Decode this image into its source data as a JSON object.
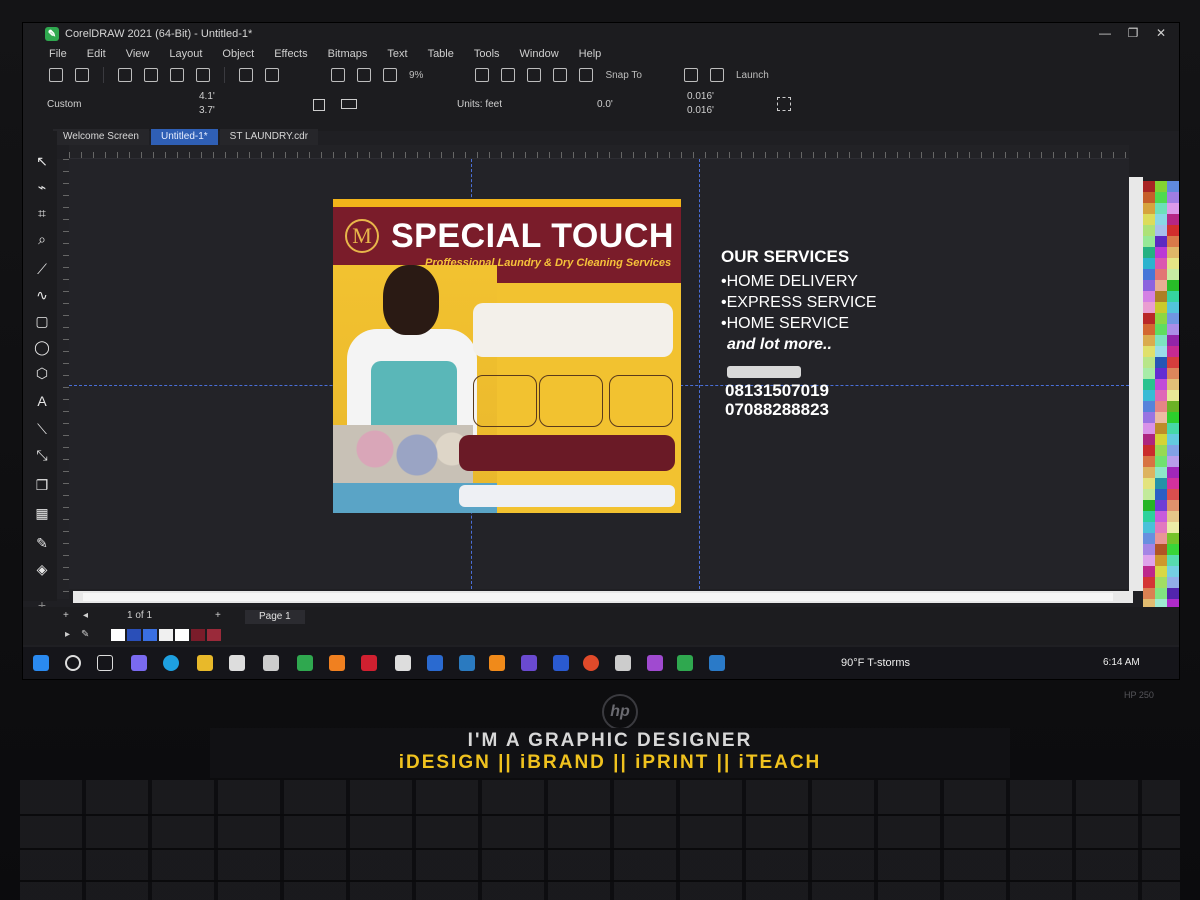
{
  "window": {
    "title": "CorelDRAW 2021 (64-Bit) - Untitled-1*",
    "controls": [
      "—",
      "❐",
      "✕"
    ]
  },
  "menu": [
    "File",
    "Edit",
    "View",
    "Layout",
    "Object",
    "Effects",
    "Bitmaps",
    "Text",
    "Table",
    "Tools",
    "Window",
    "Help"
  ],
  "toolbar": {
    "zoom": "9%",
    "snap_to": "Snap To",
    "launch": "Launch"
  },
  "propbar": {
    "preset": "Custom",
    "width": "4.1'",
    "height": "3.7'",
    "units": "Units: feet",
    "nudge": "0.0'",
    "dup_x": "0.016'",
    "dup_y": "0.016'"
  },
  "tabs": [
    "Welcome Screen",
    "Untitled-1*",
    "ST LAUNDRY.cdr"
  ],
  "flyer": {
    "logo": "M",
    "title": "SPECIAL TOUCH",
    "subtitle": "Proffessional Laundry & Dry Cleaning Services"
  },
  "services": {
    "heading": "OUR SERVICES",
    "items": [
      "•HOME DELIVERY",
      "•EXPRESS SERVICE",
      "•HOME SERVICE"
    ],
    "more": "and lot more..",
    "phones": [
      "08131507019",
      "07088288823"
    ]
  },
  "page_nav": {
    "page_count": "1 of 1",
    "page_tab": "Page 1"
  },
  "taskbar": {
    "weather": "90°F  T-storms",
    "time": "6:14 AM"
  },
  "laptop": {
    "brand": "hp",
    "model": "HP 250",
    "sticker_line1": "I'M A GRAPHIC DESIGNER",
    "sticker_line2": "iDESIGN || iBRAND || iPRINT || iTEACH"
  },
  "colors": {
    "flyer_yellow": "#f2c230",
    "flyer_maroon": "#7a1c2a",
    "accent_blue": "#2f5fb5"
  }
}
